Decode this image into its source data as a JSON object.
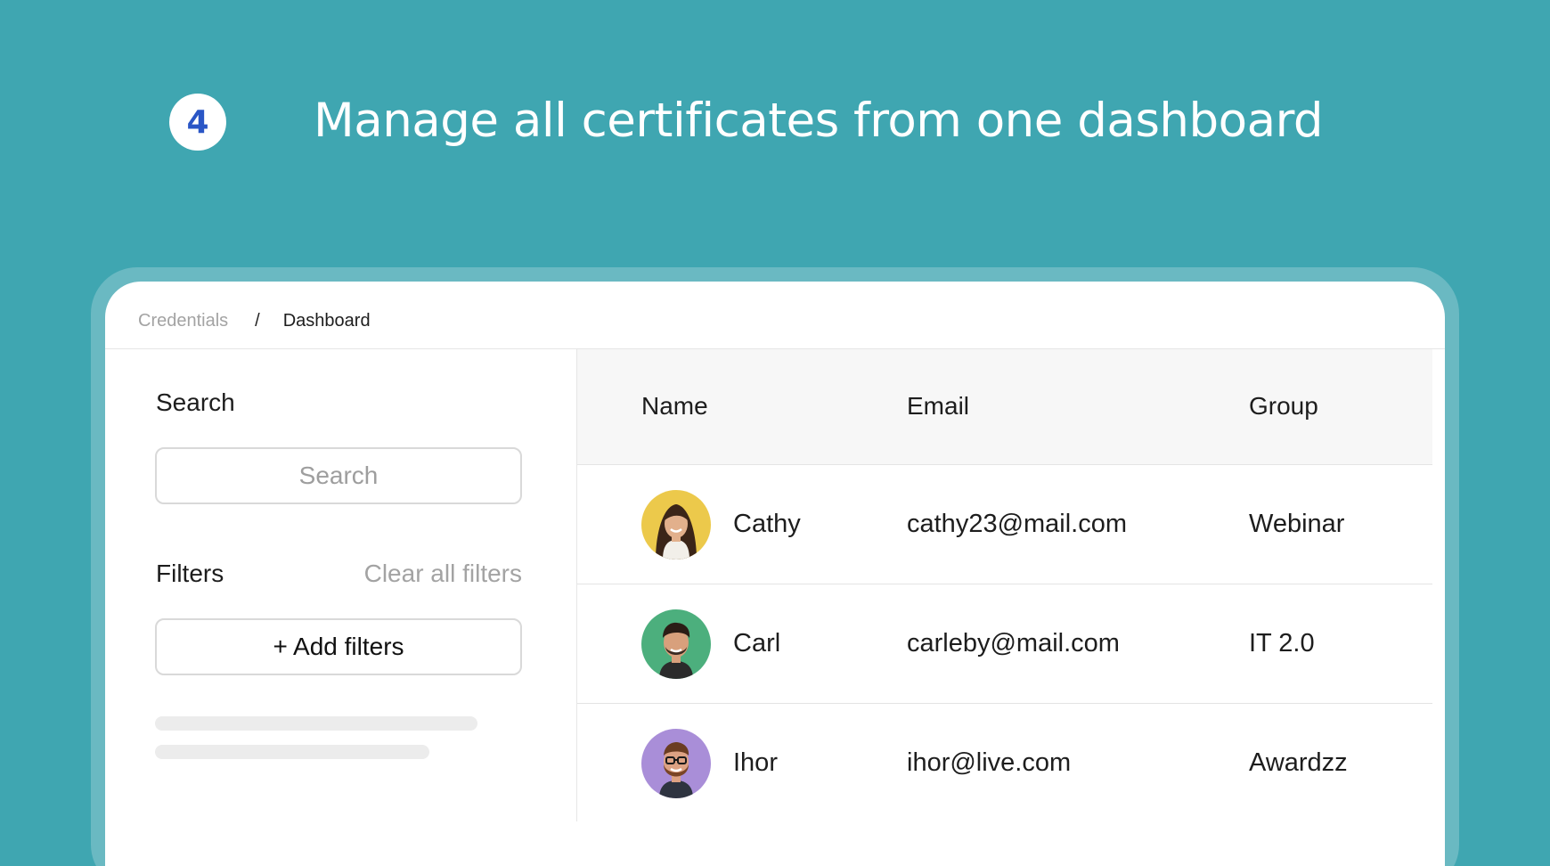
{
  "hero": {
    "step_number": "4",
    "title": "Manage all certificates from one dashboard"
  },
  "breadcrumb": {
    "root": "Credentials",
    "separator": "/",
    "current": "Dashboard"
  },
  "sidebar": {
    "search_label": "Search",
    "search_placeholder": "Search",
    "filters_label": "Filters",
    "clear_filters_label": "Clear all filters",
    "add_filters_label": "+ Add filters"
  },
  "table": {
    "columns": [
      "Name",
      "Email",
      "Group"
    ],
    "rows": [
      {
        "name": "Cathy",
        "email": "cathy23@mail.com",
        "group": "Webinar",
        "avatar_color": "#ecc94b"
      },
      {
        "name": "Carl",
        "email": "carleby@mail.com",
        "group": "IT 2.0",
        "avatar_color": "#4caf7d"
      },
      {
        "name": "Ihor",
        "email": "ihor@live.com",
        "group": "Awardzz",
        "avatar_color": "#a98ed8"
      }
    ]
  },
  "colors": {
    "background": "#3fa6b1",
    "badge_text": "#2a56c6"
  }
}
